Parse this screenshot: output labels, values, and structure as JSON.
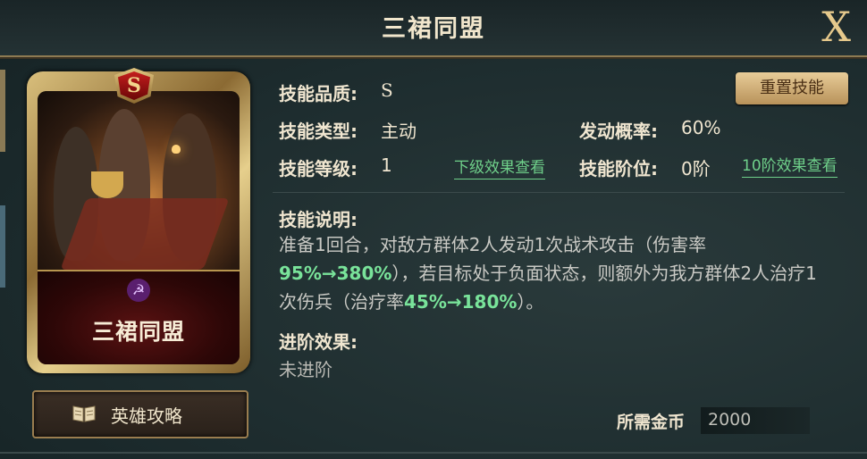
{
  "title": "三裙同盟",
  "close_label": "X",
  "card": {
    "grade": "S",
    "name": "三裙同盟",
    "faction_emblem": "☭"
  },
  "guide_button": {
    "label": "英雄攻略",
    "icon": "book-icon"
  },
  "reset_button": "重置技能",
  "fields": {
    "quality_label": "技能品质:",
    "quality_value": "S",
    "type_label": "技能类型:",
    "type_value": "主动",
    "chance_label": "发动概率:",
    "chance_value": "60%",
    "level_label": "技能等级:",
    "level_value": "1",
    "next_level_link": "下级效果查看",
    "tier_label": "技能阶位:",
    "tier_value": "0阶",
    "tier10_link": "10阶效果查看"
  },
  "description": {
    "label": "技能说明:",
    "seg1": "准备1回合，对敌方群体2人发动1次战术攻击（伤害率",
    "hl1": "95%→380%",
    "seg2": "），若目标处于负面状态，则额外为我方群体2人治疗1次伤兵（治疗率",
    "hl2": "45%→180%",
    "seg3": "）。"
  },
  "advance": {
    "label": "进阶效果:",
    "value": "未进阶"
  },
  "cost": {
    "label": "所需金币",
    "value": "2000"
  },
  "colors": {
    "highlight": "#79e39a",
    "gold": "#e6c98c",
    "text": "#f0e6d0"
  }
}
